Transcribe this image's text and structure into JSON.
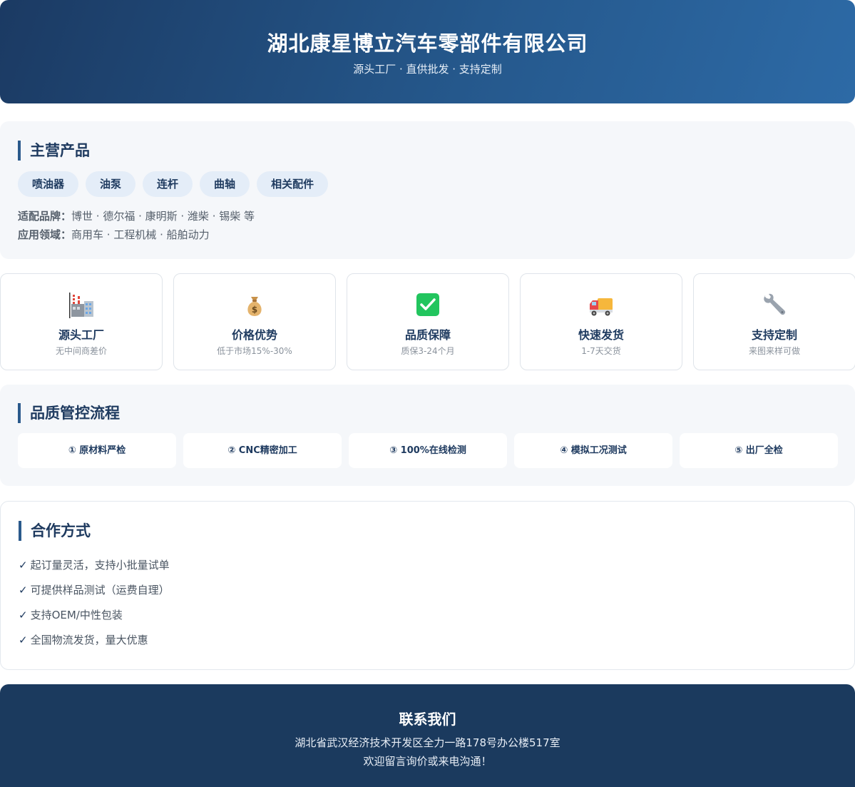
{
  "header": {
    "title": "湖北康星博立汽车零部件有限公司",
    "subtitle": "源头工厂 · 直供批发 · 支持定制"
  },
  "products": {
    "heading": "主营产品",
    "tags": [
      "喷油器",
      "油泵",
      "连杆",
      "曲轴",
      "相关配件"
    ],
    "brands_label": "适配品牌：",
    "brands_value": "博世 · 德尔福 · 康明斯 · 潍柴 · 锡柴 等",
    "fields_label": "应用领域：",
    "fields_value": "商用车 · 工程机械 · 船舶动力"
  },
  "features": [
    {
      "icon": "factory-icon",
      "title": "源头工厂",
      "desc": "无中间商差价"
    },
    {
      "icon": "money-bag-icon",
      "title": "价格优势",
      "desc": "低于市场15%-30%"
    },
    {
      "icon": "check-icon",
      "title": "品质保障",
      "desc": "质保3-24个月"
    },
    {
      "icon": "truck-icon",
      "title": "快速发货",
      "desc": "1-7天交货"
    },
    {
      "icon": "wrench-icon",
      "title": "支持定制",
      "desc": "来图来样可做"
    }
  ],
  "quality": {
    "heading": "品质管控流程",
    "steps": [
      "① 原材料严检",
      "② CNC精密加工",
      "③ 100%在线检测",
      "④ 模拟工况测试",
      "⑤ 出厂全检"
    ]
  },
  "cooperation": {
    "heading": "合作方式",
    "check_mark": "✓",
    "items": [
      "起订量灵活，支持小批量试单",
      "可提供样品测试（运费自理）",
      "支持OEM/中性包装",
      "全国物流发货，量大优惠"
    ]
  },
  "contact": {
    "title": "联系我们",
    "address": "湖北省武汉经济技术开发区全力一路178号办公楼517室",
    "message": "欢迎留言询价或来电沟通！"
  },
  "colors": {
    "primary": "#1e3a5f",
    "accent": "#2b5a8c",
    "tag_bg": "#e4edf8",
    "check_green": "#22c55e"
  }
}
